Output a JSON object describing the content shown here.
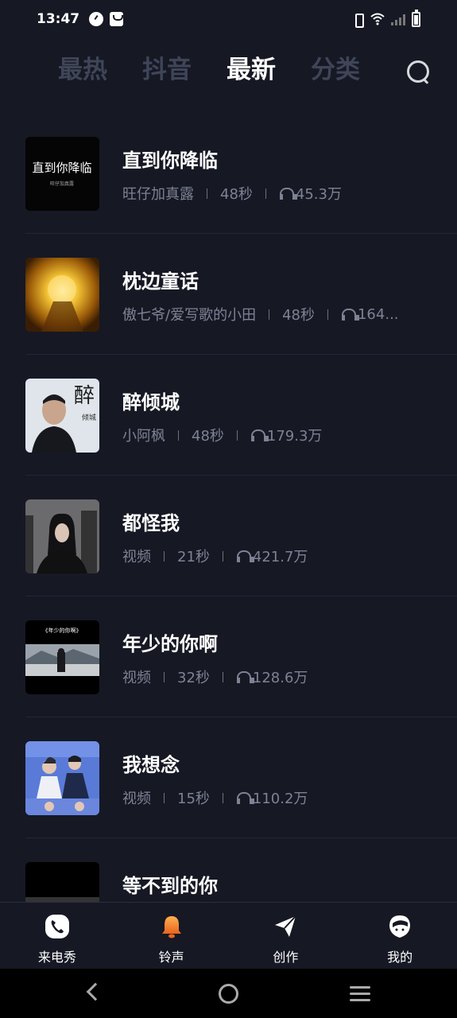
{
  "status_bar": {
    "time": "13:47"
  },
  "tabs": [
    {
      "label": "最热",
      "active": false
    },
    {
      "label": "抖音",
      "active": false
    },
    {
      "label": "最新",
      "active": true
    },
    {
      "label": "分类",
      "active": false
    }
  ],
  "songs": [
    {
      "title": "直到你降临",
      "artist": "旺仔加真露",
      "duration": "48秒",
      "plays": "45.3万",
      "cover_text": "直到你降临",
      "cover_subtext": "旺仔加真露"
    },
    {
      "title": "枕边童话",
      "artist": "傲七爷/爱写歌的小田",
      "duration": "48秒",
      "plays": "164..."
    },
    {
      "title": "醉倾城",
      "artist": "小阿枫",
      "duration": "48秒",
      "plays": "179.3万",
      "cover_text": "醉",
      "cover_subtext": "倾城"
    },
    {
      "title": "都怪我",
      "artist": "视频",
      "duration": "21秒",
      "plays": "421.7万"
    },
    {
      "title": "年少的你啊",
      "artist": "视频",
      "duration": "32秒",
      "plays": "128.6万",
      "cover_text": "《年少的你啊》"
    },
    {
      "title": "我想念",
      "artist": "视频",
      "duration": "15秒",
      "plays": "110.2万"
    },
    {
      "title": "等不到的你",
      "artist": "",
      "duration": "",
      "plays": ""
    }
  ],
  "bottom_nav": [
    {
      "label": "来电秀",
      "icon": "phone-icon",
      "active": false
    },
    {
      "label": "铃声",
      "icon": "bell-icon",
      "active": true
    },
    {
      "label": "创作",
      "icon": "paper-plane-icon",
      "active": false
    },
    {
      "label": "我的",
      "icon": "profile-icon",
      "active": false
    }
  ],
  "colors": {
    "background": "#161824",
    "accent": "#f28a30",
    "muted": "#7d8294"
  }
}
